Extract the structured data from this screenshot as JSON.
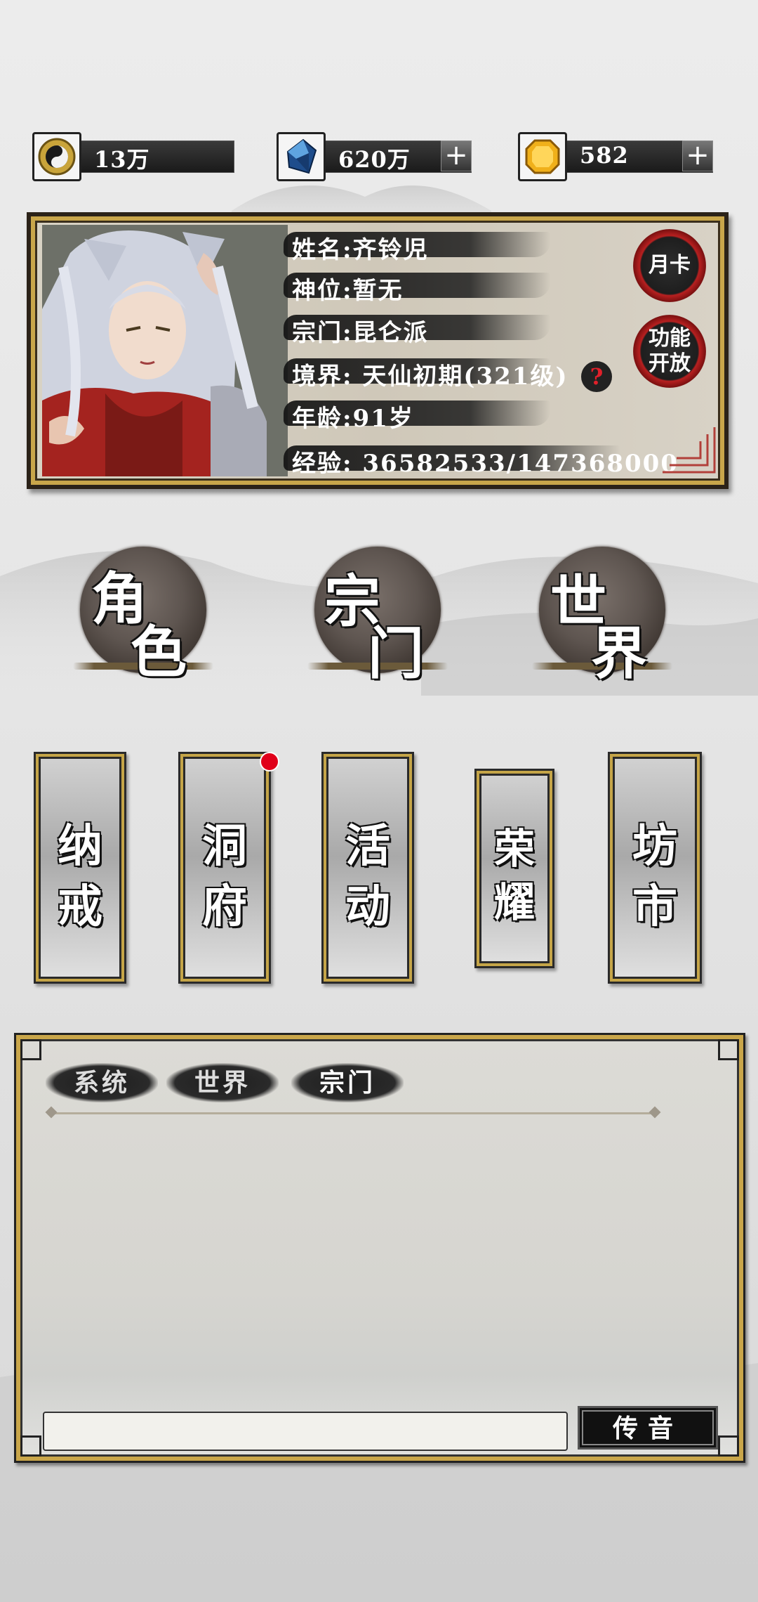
{
  "resources": [
    {
      "icon": "yin-yang-coin-icon",
      "value": "13万",
      "has_plus": false
    },
    {
      "icon": "blue-crystal-icon",
      "value": "620万",
      "has_plus": true
    },
    {
      "icon": "gold-gem-icon",
      "value": "582",
      "has_plus": true
    }
  ],
  "plus_symbol": "+",
  "character": {
    "name": "姓名:齐铃児",
    "title": "神位:暂无",
    "sect": "宗门:昆仑派",
    "realm": "境界: 天仙初期(321级)",
    "age": "年龄:91岁",
    "exp": "经验: 36582533/147368000",
    "help_symbol": "?"
  },
  "side_buttons": {
    "monthly_card": "月卡",
    "feature_open": "功能开放"
  },
  "main_buttons": {
    "character": [
      "角",
      "色"
    ],
    "sect": [
      "宗",
      "门"
    ],
    "world": [
      "世",
      "界"
    ]
  },
  "scrolls": [
    {
      "id": "ring",
      "chars": [
        "纳",
        "戒"
      ],
      "badge": false
    },
    {
      "id": "cave",
      "chars": [
        "洞",
        "府"
      ],
      "badge": true
    },
    {
      "id": "event",
      "chars": [
        "活",
        "动"
      ],
      "badge": false
    },
    {
      "id": "glory",
      "chars": [
        "荣",
        "耀"
      ],
      "badge": false
    },
    {
      "id": "market",
      "chars": [
        "坊",
        "市"
      ],
      "badge": false
    }
  ],
  "chat": {
    "tabs": [
      "系统",
      "世界",
      "宗门"
    ],
    "active_tab": 2,
    "input_value": "",
    "send_label": "传音"
  }
}
